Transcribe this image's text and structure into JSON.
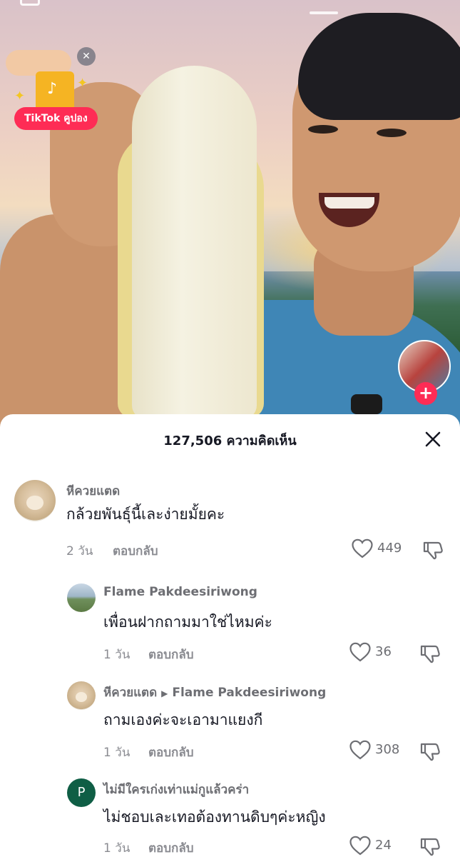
{
  "coupon": {
    "label": "TikTok คูปอง",
    "close": "✕"
  },
  "comments_header": {
    "count": "127,506",
    "label": "ความคิดเห็น"
  },
  "comments": [
    {
      "author": "หีควยแตด",
      "text": "กล้วยพันธุ์นี้เละง่ายมั้ยคะ",
      "time": "2 วัน",
      "reply_label": "ตอบกลับ",
      "likes": "449"
    },
    {
      "author": "Flame Pakdeesiriwong",
      "text": "เพื่อนฝากถามมาใช่ไหมค่ะ",
      "time": "1 วัน",
      "reply_label": "ตอบกลับ",
      "likes": "36"
    },
    {
      "author": "หีควยแตด",
      "reply_to": "Flame Pakdeesiriwong",
      "text": "ถามเองค่ะจะเอามาแยงกี",
      "time": "1 วัน",
      "reply_label": "ตอบกลับ",
      "likes": "308"
    },
    {
      "author": "ไม่มีใครเก่งเท่าแม่กูแล้วคร่า",
      "avatar_letter": "P",
      "text": "ไม่ชอบเละเทอต้องทานดิบๆค่ะหญิง",
      "time": "1 วัน",
      "reply_label": "ตอบกลับ",
      "likes": "24"
    }
  ],
  "icons": {
    "close": "close-icon",
    "like": "heart-icon",
    "dislike": "thumbs-down-icon",
    "follow": "plus-icon"
  },
  "colors": {
    "accent": "#fe2c55",
    "text": "#161823",
    "muted": "#8a8b91"
  }
}
